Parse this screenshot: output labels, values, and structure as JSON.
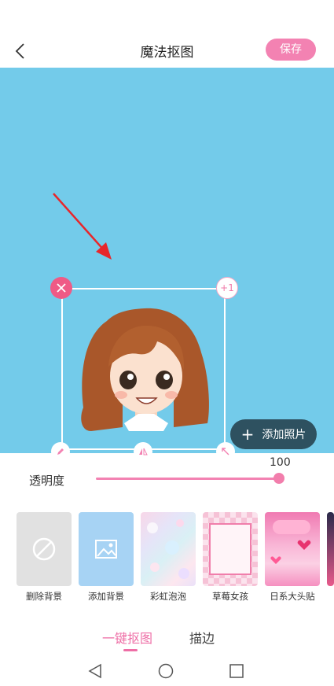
{
  "header": {
    "title": "魔法抠图",
    "save_label": "保存"
  },
  "canvas": {
    "background_color": "#73cbea",
    "duplicate_label": "+1",
    "add_photo_label": "添加照片"
  },
  "opacity": {
    "label": "透明度",
    "value": 100
  },
  "backgrounds": [
    {
      "label": "删除背景",
      "icon": "no-symbol-icon"
    },
    {
      "label": "添加背景",
      "icon": "image-icon"
    },
    {
      "label": "彩虹泡泡"
    },
    {
      "label": "草莓女孩"
    },
    {
      "label": "日系大头贴"
    }
  ],
  "tabs": [
    {
      "label": "一键抠图",
      "active": true
    },
    {
      "label": "描边",
      "active": false
    }
  ],
  "colors": {
    "accent": "#f382b2",
    "canvas_bg": "#73cbea",
    "add_photo_bg": "#2e5160"
  }
}
